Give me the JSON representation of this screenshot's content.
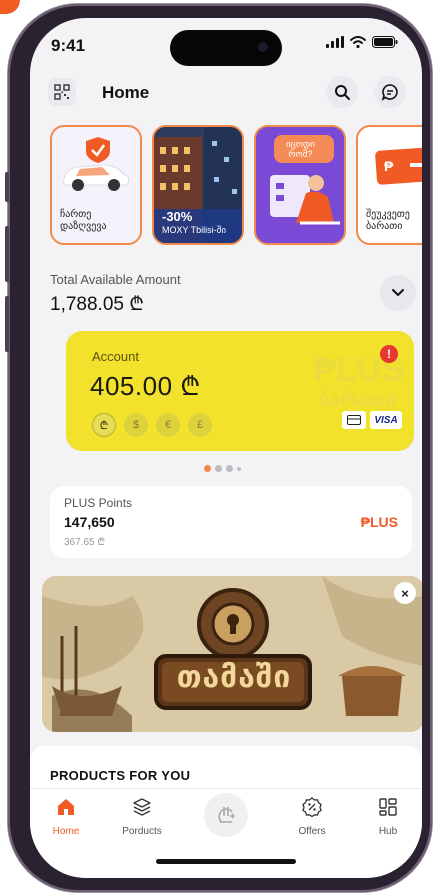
{
  "status": {
    "time": "9:41"
  },
  "header": {
    "title": "Home"
  },
  "stories": [
    {
      "label_line1": "ჩართე",
      "label_line2": "დაზღვევა"
    },
    {
      "discount": "-30%",
      "caption": "MOXY Tbilisi-ში"
    },
    {
      "bubble_line1": "იცოდი",
      "bubble_line2": "რომ?"
    },
    {
      "label_line1": "შეუკვეთე",
      "label_line2": "ბარათი"
    }
  ],
  "total": {
    "label": "Total Available Amount",
    "amount": "1,788.05 ₾"
  },
  "account": {
    "label": "Account",
    "amount": "405.00 ₾",
    "alert": "!",
    "currencies": [
      "₾",
      "$",
      "€",
      "£"
    ],
    "watermark": "₱LUS",
    "watermark_sub": "ბარათი",
    "card_brand": "VISA"
  },
  "points": {
    "label": "PLUS Points",
    "value": "147,650",
    "money": "367.65 ₾",
    "logo": "₱LUS"
  },
  "banner": {
    "title": "თამაში",
    "close": "×"
  },
  "products": {
    "title": "PRODUCTS FOR YOU"
  },
  "tabs": [
    {
      "label": "Home"
    },
    {
      "label": "Porducts"
    },
    {
      "label": ""
    },
    {
      "label": "Offers"
    },
    {
      "label": "Hub"
    }
  ],
  "colors": {
    "accent": "#f05a24",
    "card_yellow": "#f2e22c",
    "story_border": "#f08a4b"
  }
}
